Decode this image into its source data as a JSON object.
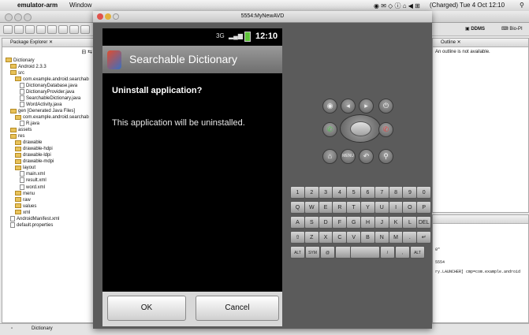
{
  "menubar": {
    "apple": "",
    "app": "emulator-arm",
    "window": "Window",
    "charged": "(Charged)",
    "clock": "Tue 4 Oct  12:10"
  },
  "eclipse": {
    "package_explorer_tab": "Package Explorer",
    "tree": [
      {
        "label": "Dictionary",
        "indent": 0,
        "kind": "project"
      },
      {
        "label": "Android 2.3.3",
        "indent": 1,
        "kind": "lib"
      },
      {
        "label": "src",
        "indent": 1,
        "kind": "folder"
      },
      {
        "label": "com.example.android.searchab",
        "indent": 2,
        "kind": "pkg"
      },
      {
        "label": "DictionaryDatabase.java",
        "indent": 3,
        "kind": "file"
      },
      {
        "label": "DictionaryProvider.java",
        "indent": 3,
        "kind": "file"
      },
      {
        "label": "SearchableDictionary.java",
        "indent": 3,
        "kind": "file"
      },
      {
        "label": "WordActivity.java",
        "indent": 3,
        "kind": "file"
      },
      {
        "label": "gen [Generated Java Files]",
        "indent": 1,
        "kind": "folder"
      },
      {
        "label": "com.example.android.searchab",
        "indent": 2,
        "kind": "pkg"
      },
      {
        "label": "R.java",
        "indent": 3,
        "kind": "file"
      },
      {
        "label": "assets",
        "indent": 1,
        "kind": "folder"
      },
      {
        "label": "res",
        "indent": 1,
        "kind": "folder"
      },
      {
        "label": "drawable",
        "indent": 2,
        "kind": "folder"
      },
      {
        "label": "drawable-hdpi",
        "indent": 2,
        "kind": "folder"
      },
      {
        "label": "drawable-ldpi",
        "indent": 2,
        "kind": "folder"
      },
      {
        "label": "drawable-mdpi",
        "indent": 2,
        "kind": "folder"
      },
      {
        "label": "layout",
        "indent": 2,
        "kind": "folder"
      },
      {
        "label": "main.xml",
        "indent": 3,
        "kind": "file"
      },
      {
        "label": "result.xml",
        "indent": 3,
        "kind": "file"
      },
      {
        "label": "word.xml",
        "indent": 3,
        "kind": "file"
      },
      {
        "label": "menu",
        "indent": 2,
        "kind": "folder"
      },
      {
        "label": "raw",
        "indent": 2,
        "kind": "folder"
      },
      {
        "label": "values",
        "indent": 2,
        "kind": "folder"
      },
      {
        "label": "xml",
        "indent": 2,
        "kind": "folder"
      },
      {
        "label": "AndroidManifest.xml",
        "indent": 1,
        "kind": "file"
      },
      {
        "label": "default.properties",
        "indent": 1,
        "kind": "file"
      }
    ],
    "ddms": "DDMS",
    "bio": "Bio-PI",
    "outline_tab": "Outline",
    "outline_msg": "An outline is not available.",
    "console_lines": [
      "0\"",
      "5554",
      "ry.LAUNCHER] cmp=com.example.android"
    ],
    "status_label": "Dictionary"
  },
  "emulator": {
    "title": "5554:MyNewAVD",
    "clock": "12:10",
    "app_title": "Searchable Dictionary",
    "dialog_title": "Uninstall application?",
    "dialog_message": "This application will be uninstalled.",
    "ok": "OK",
    "cancel": "Cancel",
    "keys_row1": [
      "1",
      "2",
      "3",
      "4",
      "5",
      "6",
      "7",
      "8",
      "9",
      "0"
    ],
    "keys_row2": [
      "Q",
      "W",
      "E",
      "R",
      "T",
      "Y",
      "U",
      "I",
      "O",
      "P"
    ],
    "keys_row3": [
      "A",
      "S",
      "D",
      "F",
      "G",
      "H",
      "J",
      "K",
      "L",
      "DEL"
    ],
    "keys_row4": [
      "⇧",
      "Z",
      "X",
      "C",
      "V",
      "B",
      "N",
      "M",
      ".",
      "↵"
    ],
    "keys_row5": [
      "ALT",
      "SYM",
      "@",
      "",
      "",
      "/",
      ",",
      "ALT"
    ],
    "menu_label": "MENU"
  }
}
